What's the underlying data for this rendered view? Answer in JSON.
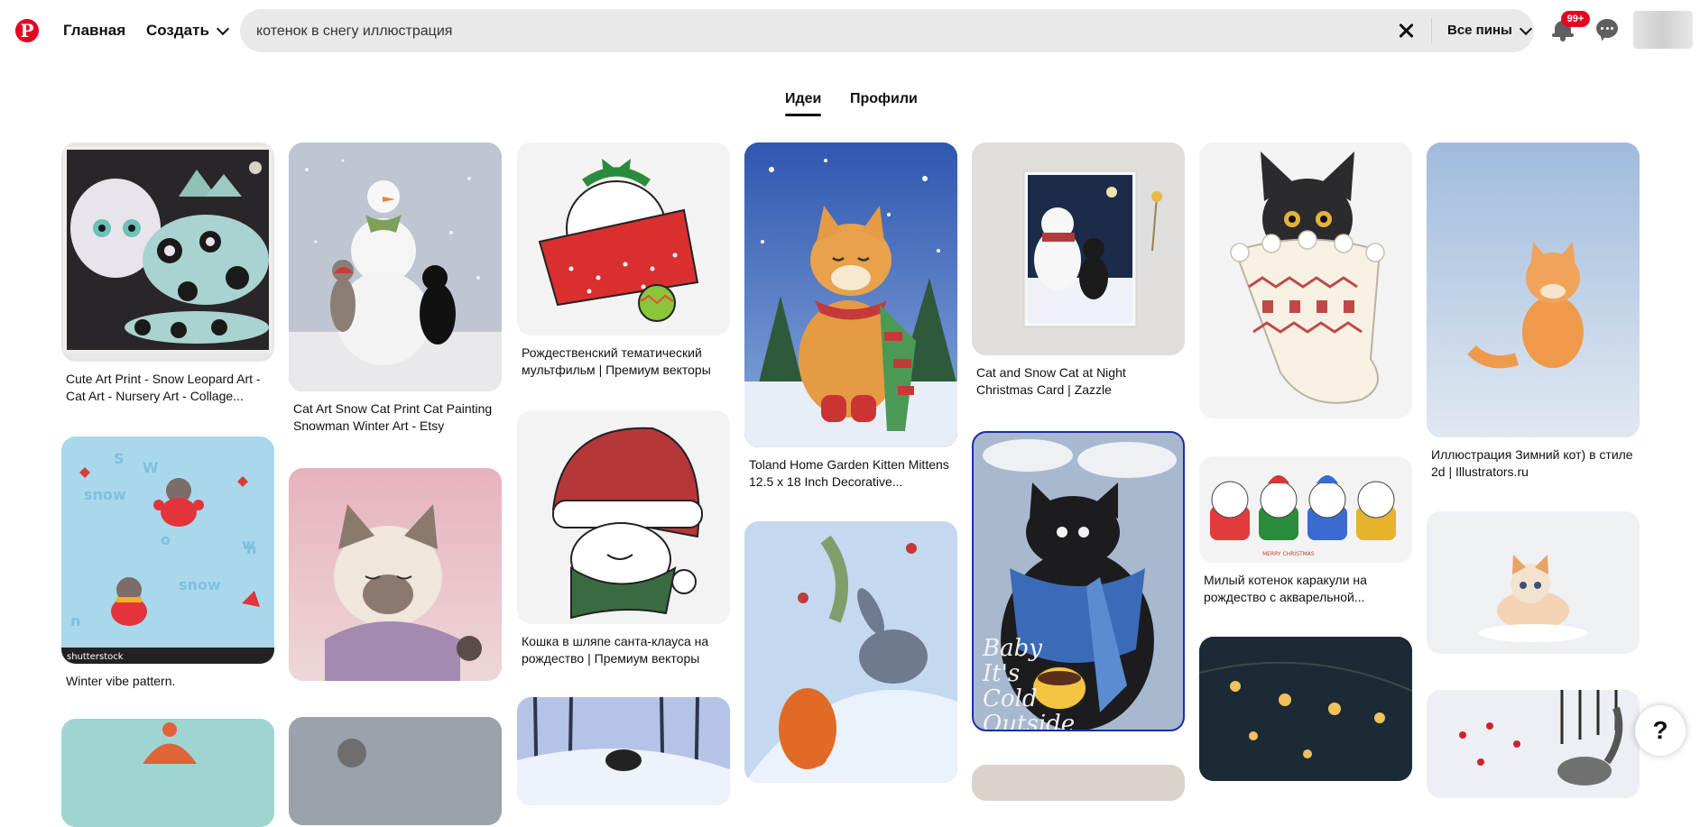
{
  "header": {
    "logo_icon": "pinterest-logo",
    "home": "Главная",
    "create": "Создать",
    "search_value": "котенок в снегу иллюстрация",
    "filter": "Все пины",
    "notifications_badge": "99+"
  },
  "tabs": {
    "ideas": "Идеи",
    "profiles": "Профили"
  },
  "pins": [
    {
      "caption": "Cute Art Print - Snow Leopard Art - Cat Art - Nursery Art - Collage..."
    },
    {
      "caption": "Cat Art Snow Cat Print Cat Painting Snowman Winter Art - Etsy"
    },
    {
      "caption": "Рождественский тематический мультфильм | Премиум векторы"
    },
    {
      "caption": "Toland Home Garden Kitten Mittens 12.5 x 18 Inch Decorative..."
    },
    {
      "caption": "Cat and Snow Cat at Night Christmas Card | Zazzle"
    },
    {
      "caption": ""
    },
    {
      "caption": "Иллюстрация Зимний кот) в стиле 2d | Illustrators.ru"
    },
    {
      "caption": "Winter vibe pattern.",
      "overlay": "shutterstock"
    },
    {
      "caption": ""
    },
    {
      "caption": "Кошка в шляпе санта-клауса на рождество | Премиум векторы"
    },
    {
      "caption": ""
    },
    {
      "caption": "",
      "overlay": "Baby It's Cold Outside"
    },
    {
      "caption": "Милый котенок каракули на рождество с акварельной..."
    },
    {
      "caption": ""
    }
  ],
  "help": "?"
}
